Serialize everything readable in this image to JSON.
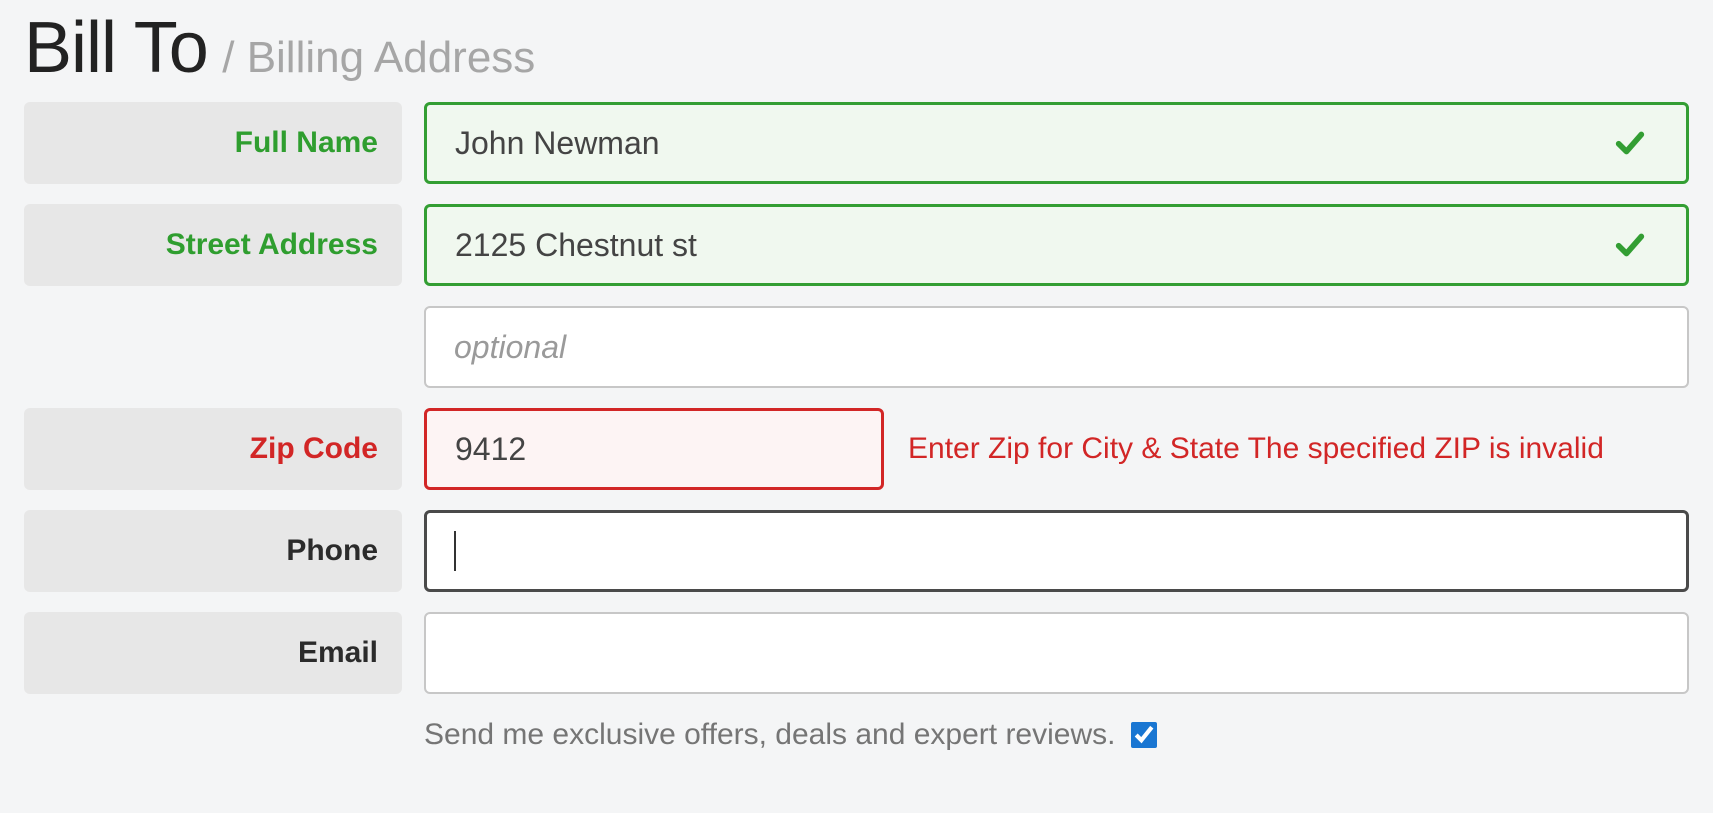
{
  "heading": {
    "primary": "Bill To",
    "divider": "/",
    "secondary": "Billing Address"
  },
  "labels": {
    "full_name": "Full Name",
    "street": "Street Address",
    "zip": "Zip Code",
    "phone": "Phone",
    "email": "Email"
  },
  "fields": {
    "full_name": {
      "value": "John Newman"
    },
    "street": {
      "value": "2125 Chestnut st"
    },
    "street2": {
      "value": "",
      "placeholder": "optional"
    },
    "zip": {
      "value": "9412"
    },
    "phone": {
      "value": ""
    },
    "email": {
      "value": ""
    }
  },
  "errors": {
    "zip_primary": "Enter Zip for City & State",
    "zip_secondary": "The specified ZIP is invalid"
  },
  "checkbox": {
    "label": "Send me exclusive offers, deals and expert reviews.",
    "checked": true
  },
  "colors": {
    "valid": "#339e33",
    "invalid": "#d22626",
    "label_bg": "#e7e7e7",
    "page_bg": "#f4f5f6"
  }
}
